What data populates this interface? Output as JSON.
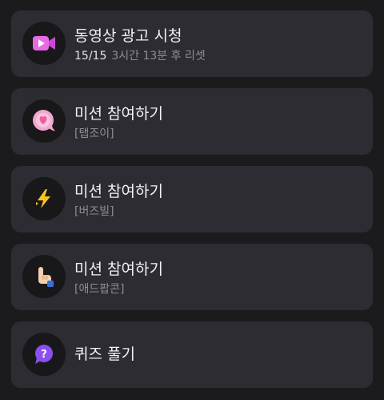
{
  "items": [
    {
      "icon": "video-play-icon",
      "title": "동영상 광고 시청",
      "count": "15/15",
      "subtitle": "3시간 13분 후 리셋",
      "colors": {
        "icon": "#e36be0"
      }
    },
    {
      "icon": "heart-bubble-icon",
      "title": "미션 참여하기",
      "subtitle": "[탭조이]",
      "colors": {
        "icon": "#f39ac8"
      }
    },
    {
      "icon": "lightning-bolt-icon",
      "title": "미션 참여하기",
      "subtitle": "[버즈빌]",
      "colors": {
        "icon": "#f6c21c"
      }
    },
    {
      "icon": "pointing-hand-icon",
      "title": "미션 참여하기",
      "subtitle": "[애드팝콘]",
      "colors": {
        "icon": "#f4cfae"
      }
    },
    {
      "icon": "question-bubble-icon",
      "title": "퀴즈 풀기",
      "colors": {
        "icon": "#8a4dee"
      }
    }
  ]
}
